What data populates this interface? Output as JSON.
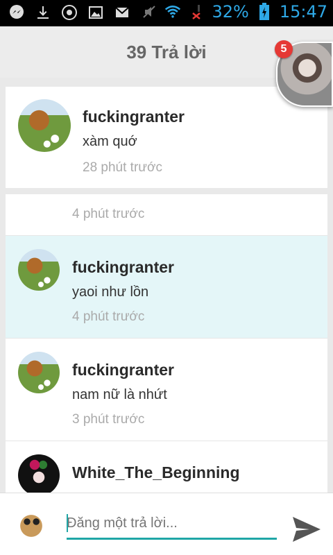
{
  "statusbar": {
    "battery_pct": "32%",
    "time": "15:47",
    "icons": [
      "messenger-icon",
      "download-icon",
      "chrome-icon",
      "image-icon",
      "gmail-icon",
      "mute-icon",
      "wifi-icon",
      "no-signal-icon",
      "battery-icon"
    ]
  },
  "header": {
    "title": "39 Trả lời"
  },
  "chathead": {
    "badge": "5"
  },
  "top_comment": {
    "user": "fuckingranter",
    "text": "xàm quớ",
    "time": "28 phút trước"
  },
  "comments": [
    {
      "user": "",
      "text": "",
      "time": "4 phút trước"
    },
    {
      "user": "fuckingranter",
      "text": "yaoi như lồn",
      "time": "4 phút trước"
    },
    {
      "user": "fuckingranter",
      "text": "nam nữ là nhứt",
      "time": "3 phút trước"
    },
    {
      "user": "White_The_Beginning",
      "text": "",
      "time": ""
    }
  ],
  "composer": {
    "placeholder": "Đăng một trả lời..."
  },
  "colors": {
    "accent": "#1fa6a6",
    "highlight_row": "#e4f6f8",
    "status_blue": "#2ea8e6",
    "badge_red": "#e53935"
  }
}
